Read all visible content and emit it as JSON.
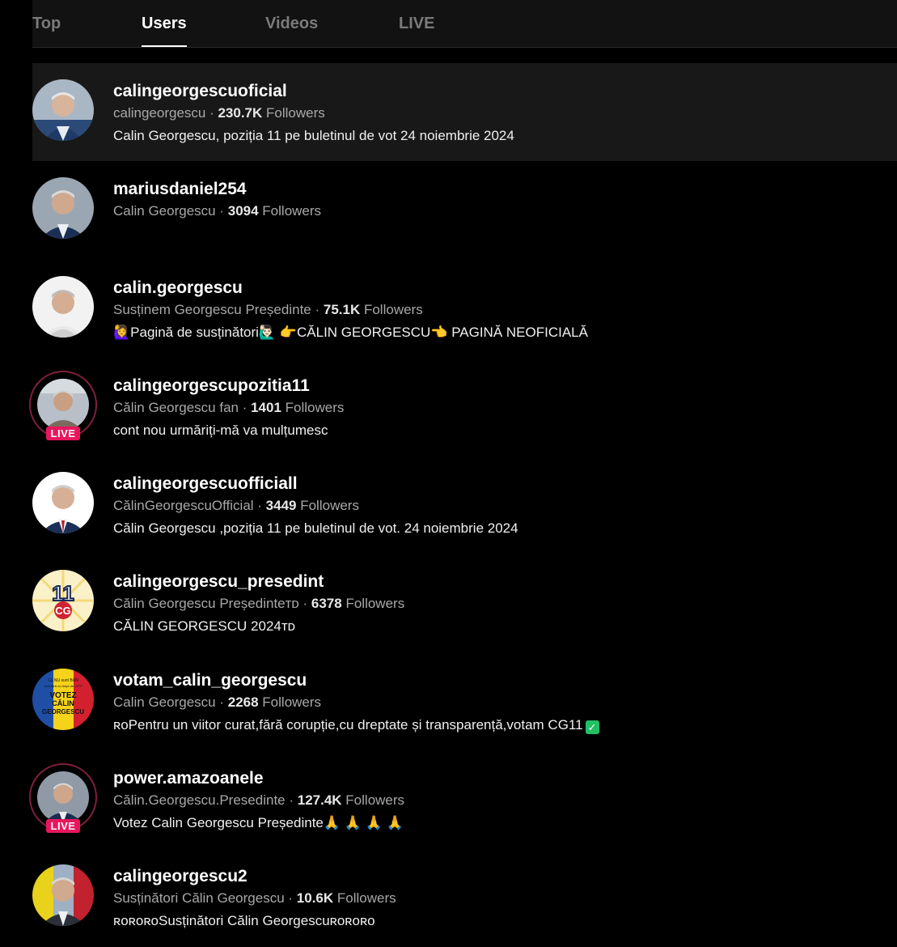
{
  "tabs": [
    {
      "label": "Top"
    },
    {
      "label": "Users"
    },
    {
      "label": "Videos"
    },
    {
      "label": "LIVE"
    }
  ],
  "active_tab": "Users",
  "live_badge_text": "LIVE",
  "followers_word": "Followers",
  "users": [
    {
      "username": "calingeorgescuoficial",
      "nickname": "calingeorgescu",
      "followers": "230.7K",
      "bio": "Calin Georgescu, poziția 11 pe buletinul de vot 24 noiembrie 2024",
      "live": false
    },
    {
      "username": "mariusdaniel254",
      "nickname": "Calin Georgescu",
      "followers": "3094",
      "bio": "",
      "live": false
    },
    {
      "username": "calin.georgescu",
      "nickname": "Susținem Georgescu Președinte",
      "followers": "75.1K",
      "bio": "🙋‍♀️Pagină de susținători🙋🏻‍♂️  👉CĂLIN GEORGESCU👈  PAGINĂ NEOFICIALĂ",
      "live": false
    },
    {
      "username": "calingeorgescupozitia11",
      "nickname": "Călin Georgescu fan",
      "followers": "1401",
      "bio": "cont nou urmăriți-mă va mulțumesc",
      "live": true
    },
    {
      "username": "calingeorgescuofficiall",
      "nickname": "CălinGeorgescuOfficial",
      "followers": "3449",
      "bio": "Călin Georgescu ,poziția 11 pe buletinul de vot. 24 noiembrie 2024",
      "live": false
    },
    {
      "username": "calingeorgescu_presedint",
      "nickname": "Călin Georgescu Președinteᴛᴅ",
      "followers": "6378",
      "bio": "CĂLIN GEORGESCU 2024ᴛᴅ",
      "live": false
    },
    {
      "username": "votam_calin_georgescu",
      "nickname": "Calin Georgescu",
      "followers": "2268",
      "bio": "ʀᴏPentru un viitor curat,fără corupție,cu dreptate și transparență,votam CG11",
      "live": false,
      "check": "✓"
    },
    {
      "username": "power.amazoanele",
      "nickname": "Călin.Georgescu.Presedinte",
      "followers": "127.4K",
      "bio": "Votez Calin Georgescu Președinte🙏 🙏 🙏 🙏",
      "live": true
    },
    {
      "username": "calingeorgescu2",
      "nickname": "Susținători Călin Georgescu",
      "followers": "10.6K",
      "bio": "ʀᴏʀᴏʀᴏSusținători Călin Georgescuʀᴏʀᴏʀᴏ",
      "live": false
    }
  ],
  "avatars": [
    {
      "lettering": []
    },
    {
      "lettering": []
    },
    {
      "lettering": []
    },
    {
      "lettering": []
    },
    {
      "lettering": []
    },
    {
      "lettering": [
        "11",
        "CG"
      ]
    },
    {
      "lettering": [
        "Cu NU sunt BUN",
        "sunt fără cu drept de VOT!",
        "VOTEZ",
        "CĂLIN",
        "GEORGESCU"
      ]
    },
    {
      "lettering": []
    },
    {
      "lettering": []
    }
  ],
  "colors": {
    "background": "#000000",
    "highlight_row": "#181818",
    "live_badge": "#e8175d",
    "live_ring": "#7d1f3e",
    "check_green": "#21c064"
  }
}
